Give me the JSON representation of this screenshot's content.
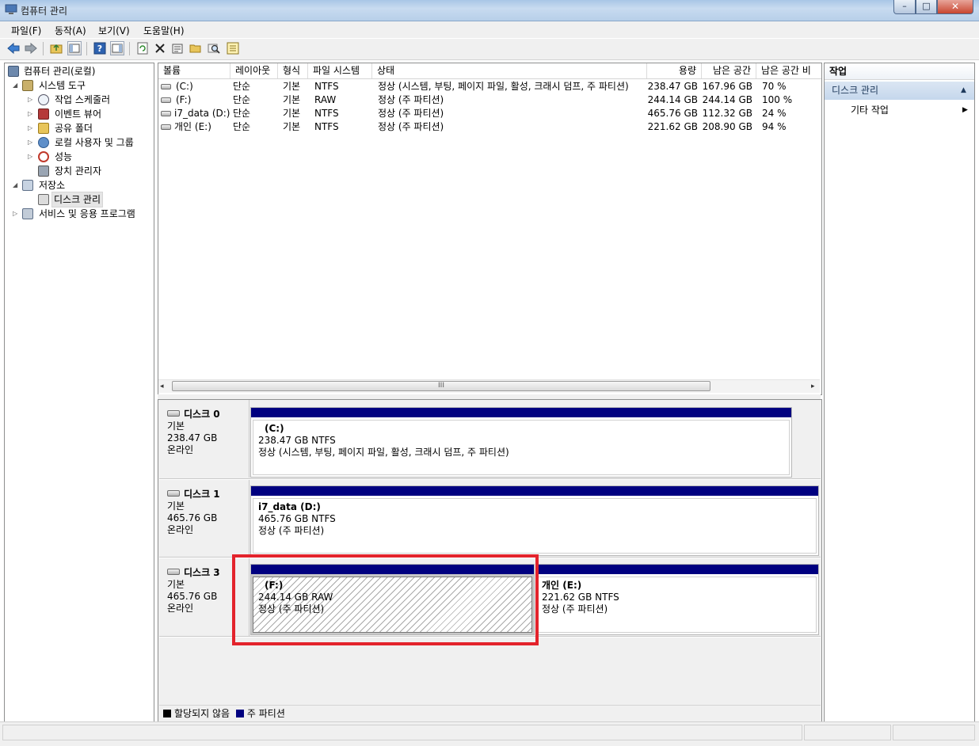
{
  "window": {
    "title": "컴퓨터 관리",
    "buttons": {
      "minimize": "–",
      "maximize": "□",
      "close": "✕"
    }
  },
  "menu": [
    "파일(F)",
    "동작(A)",
    "보기(V)",
    "도움말(H)"
  ],
  "toolbar": {
    "icons": [
      "back-arrow-icon",
      "forward-arrow-icon",
      "up-folder-icon",
      "show-hide-tree-icon",
      "help-icon",
      "show-hide-action-pane-icon",
      "refresh-icon",
      "delete-icon",
      "properties-icon",
      "open-folder-icon",
      "search-icon",
      "settings-icon"
    ]
  },
  "tree": {
    "root": "컴퓨터 관리(로컬)",
    "system_tools": "시스템 도구",
    "task_scheduler": "작업 스케줄러",
    "event_viewer": "이벤트 뷰어",
    "shared_folders": "공유 폴더",
    "local_users": "로컬 사용자 및 그룹",
    "performance": "성능",
    "device_manager": "장치 관리자",
    "storage": "저장소",
    "disk_management": "디스크 관리",
    "services_apps": "서비스 및 응용 프로그램"
  },
  "volume_list": {
    "columns": [
      "볼륨",
      "레이아웃",
      "형식",
      "파일 시스템",
      "상태",
      "용량",
      "남은 공간",
      "남은 공간 비"
    ],
    "rows": [
      {
        "volume": "(C:)",
        "layout": "단순",
        "type": "기본",
        "fs": "NTFS",
        "status": "정상 (시스템, 부팅, 페이지 파일, 활성, 크래시 덤프, 주 파티션)",
        "capacity": "238.47 GB",
        "free": "167.96 GB",
        "pct": "70 %"
      },
      {
        "volume": "(F:)",
        "layout": "단순",
        "type": "기본",
        "fs": "RAW",
        "status": "정상 (주 파티션)",
        "capacity": "244.14 GB",
        "free": "244.14 GB",
        "pct": "100 %"
      },
      {
        "volume": "i7_data (D:)",
        "layout": "단순",
        "type": "기본",
        "fs": "NTFS",
        "status": "정상 (주 파티션)",
        "capacity": "465.76 GB",
        "free": "112.32 GB",
        "pct": "24 %"
      },
      {
        "volume": "개인 (E:)",
        "layout": "단순",
        "type": "기본",
        "fs": "NTFS",
        "status": "정상 (주 파티션)",
        "capacity": "221.62 GB",
        "free": "208.90 GB",
        "pct": "94 %"
      }
    ],
    "hscroll_grip": "III"
  },
  "disks": [
    {
      "name": "디스크 0",
      "type": "기본",
      "size": "238.47 GB",
      "state": "온라인",
      "partitions": [
        {
          "title": "(C:)",
          "detail": "238.47 GB NTFS",
          "status": "정상 (시스템, 부팅, 페이지 파일, 활성, 크래시 덤프, 주 파티션)"
        }
      ]
    },
    {
      "name": "디스크 1",
      "type": "기본",
      "size": "465.76 GB",
      "state": "온라인",
      "partitions": [
        {
          "title": "i7_data  (D:)",
          "detail": "465.76 GB NTFS",
          "status": "정상 (주 파티션)"
        }
      ]
    },
    {
      "name": "디스크 3",
      "type": "기본",
      "size": "465.76 GB",
      "state": "온라인",
      "partitions": [
        {
          "title": "(F:)",
          "detail": "244.14 GB RAW",
          "status": "정상 (주 파티션)",
          "selected": true
        },
        {
          "title": "개인  (E:)",
          "detail": "221.62 GB NTFS",
          "status": "정상 (주 파티션)"
        }
      ]
    }
  ],
  "legend": {
    "unallocated": "할당되지 않음",
    "primary": "주 파티션"
  },
  "actions": {
    "header": "작업",
    "section": "디스크 관리",
    "item": "기타 작업"
  },
  "colors": {
    "primary_partition": "#000080",
    "unallocated": "#000000",
    "highlight": "#e3232c"
  }
}
